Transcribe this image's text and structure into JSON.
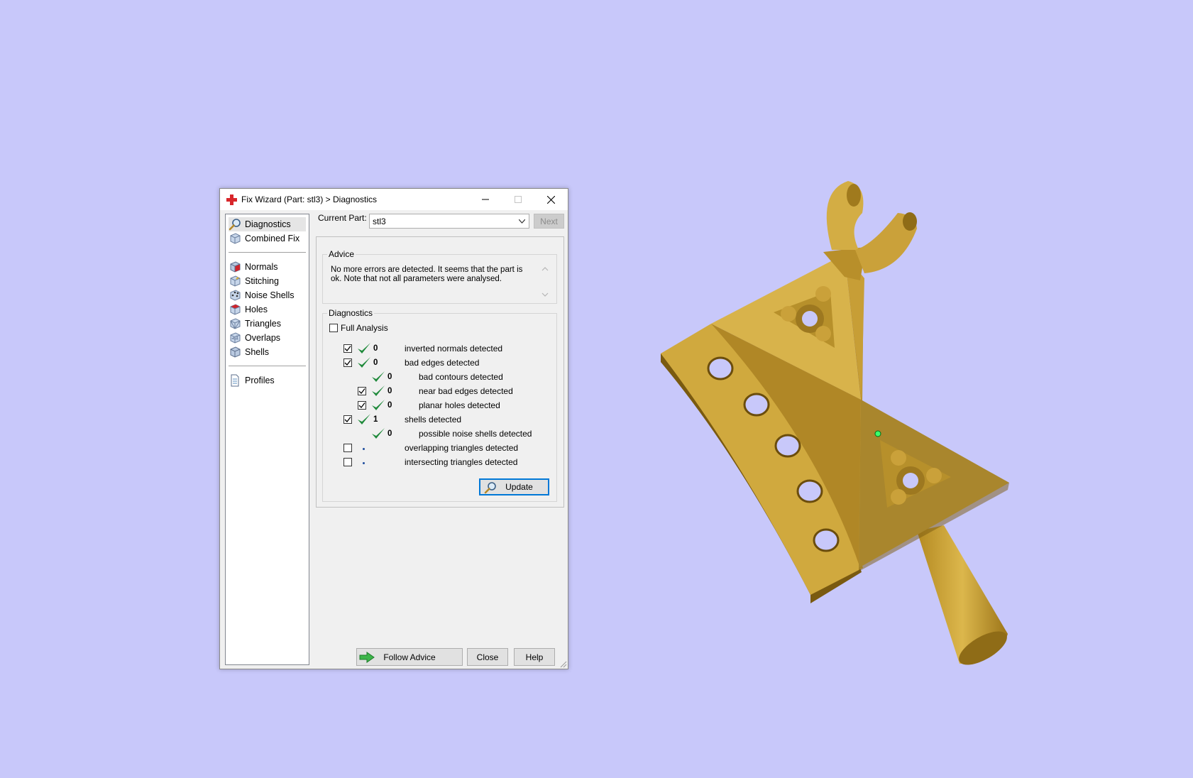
{
  "window": {
    "title": "Fix Wizard (Part: stl3) > Diagnostics"
  },
  "nav": {
    "items": [
      {
        "label": "Diagnostics",
        "icon": "magnifier-icon",
        "selected": true
      },
      {
        "label": "Combined Fix",
        "icon": "cube-icon"
      },
      {
        "label": "Normals",
        "icon": "normals-cube-icon"
      },
      {
        "label": "Stitching",
        "icon": "stitching-cube-icon"
      },
      {
        "label": "Noise Shells",
        "icon": "noise-shells-cube-icon"
      },
      {
        "label": "Holes",
        "icon": "holes-cube-icon"
      },
      {
        "label": "Triangles",
        "icon": "triangles-cube-icon"
      },
      {
        "label": "Overlaps",
        "icon": "overlaps-cube-icon"
      },
      {
        "label": "Shells",
        "icon": "shells-cube-icon"
      },
      {
        "label": "Profiles",
        "icon": "document-icon"
      }
    ]
  },
  "current_part": {
    "label": "Current Part:",
    "value": "stl3",
    "next_label": "Next"
  },
  "advice": {
    "title": "Advice",
    "text": "No more errors are detected. It seems that the part is ok. Note that not all parameters were analysed."
  },
  "diagnostics": {
    "title": "Diagnostics",
    "full_analysis_label": "Full Analysis",
    "full_analysis_checked": false,
    "rows": [
      {
        "checkbox": true,
        "checked": true,
        "status": "ok",
        "count": "0",
        "label": "inverted normals detected"
      },
      {
        "checkbox": true,
        "checked": true,
        "status": "ok",
        "count": "0",
        "label": "bad edges detected"
      },
      {
        "checkbox": false,
        "checked": false,
        "status": "ok",
        "count": "0",
        "label": "bad contours detected"
      },
      {
        "checkbox": true,
        "checked": true,
        "status": "ok",
        "count": "0",
        "label": "near bad edges detected"
      },
      {
        "checkbox": true,
        "checked": true,
        "status": "ok",
        "count": "0",
        "label": "planar holes detected"
      },
      {
        "checkbox": true,
        "checked": true,
        "status": "ok",
        "count": "1",
        "label": "shells detected"
      },
      {
        "checkbox": false,
        "checked": false,
        "status": "ok",
        "count": "0",
        "label": "possible noise shells detected"
      },
      {
        "checkbox": true,
        "checked": false,
        "status": "none",
        "count": "",
        "label": "overlapping triangles detected"
      },
      {
        "checkbox": true,
        "checked": false,
        "status": "none",
        "count": "",
        "label": "intersecting triangles detected"
      }
    ],
    "update_label": "Update"
  },
  "footer": {
    "follow_advice_label": "Follow Advice",
    "close_label": "Close",
    "help_label": "Help"
  },
  "colors": {
    "viewport_bg": "#c8c8fa",
    "model_gold": "#c9a033",
    "check_green": "#1f8a3b"
  }
}
